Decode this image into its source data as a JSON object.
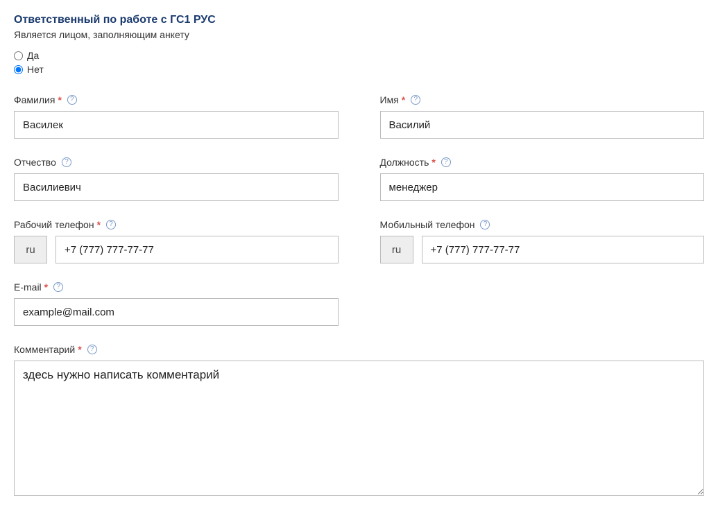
{
  "header": {
    "title": "Ответственный по работе с ГС1 РУС",
    "subtitle": "Является лицом, заполняющим анкету"
  },
  "radio": {
    "yes_label": "Да",
    "no_label": "Нет",
    "selected": "no"
  },
  "fields": {
    "lastname": {
      "label": "Фамилия",
      "required": true,
      "value": "Василек"
    },
    "firstname": {
      "label": "Имя",
      "required": true,
      "value": "Василий"
    },
    "patronymic": {
      "label": "Отчество",
      "required": false,
      "value": "Василиевич"
    },
    "position": {
      "label": "Должность",
      "required": true,
      "value": "менеджер"
    },
    "work_phone": {
      "label": "Рабочий телефон",
      "required": true,
      "prefix": "ru",
      "value": "+7 (777) 777-77-77"
    },
    "mobile_phone": {
      "label": "Мобильный телефон",
      "required": false,
      "prefix": "ru",
      "value": "+7 (777) 777-77-77"
    },
    "email": {
      "label": "E-mail",
      "required": true,
      "value": "example@mail.com"
    },
    "comment": {
      "label": "Комментарий",
      "required": true,
      "value": "здесь нужно написать комментарий"
    }
  }
}
